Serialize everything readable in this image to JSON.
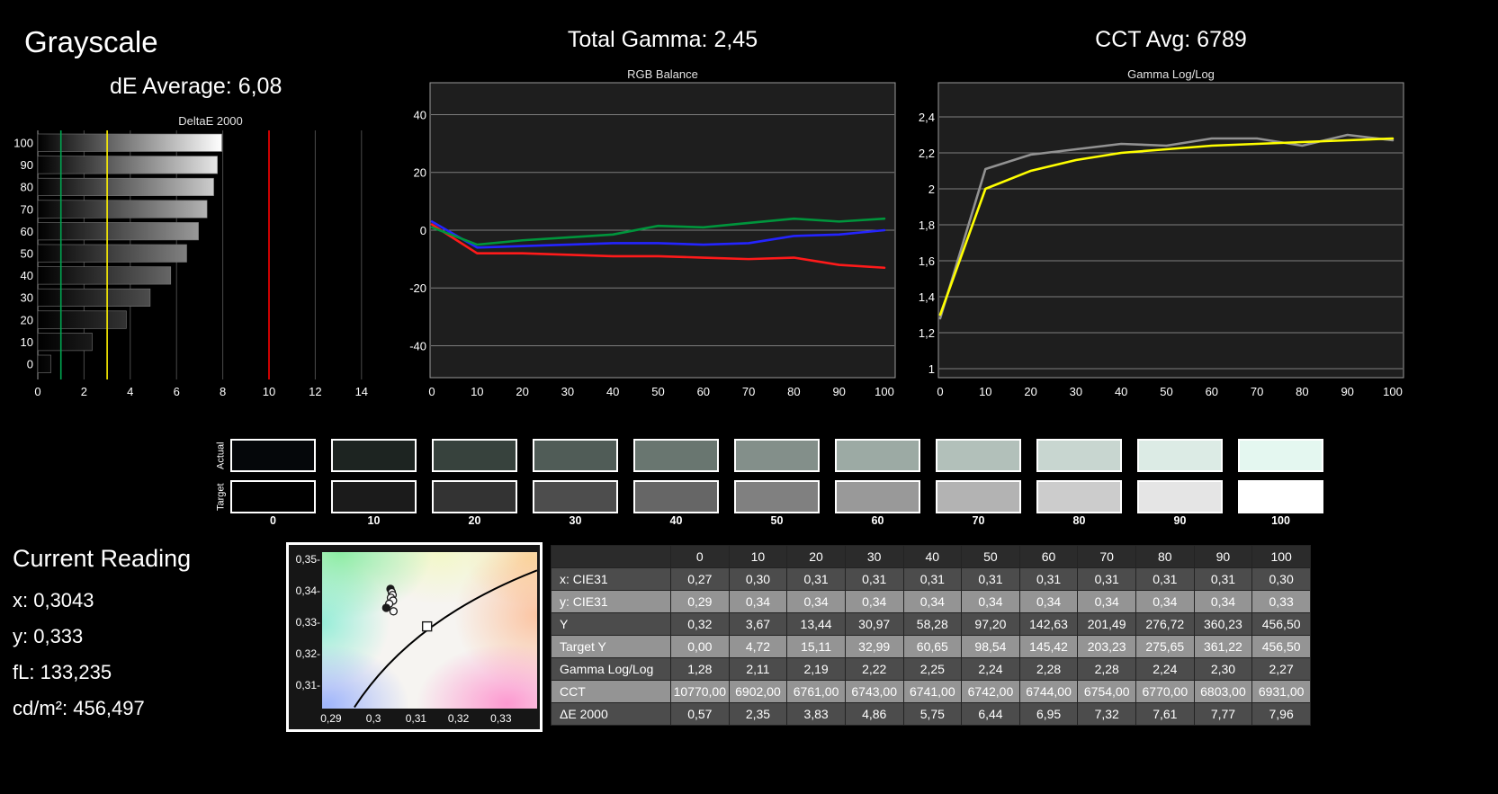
{
  "titles": {
    "grayscale": "Grayscale",
    "de_average": "dE Average: 6,08",
    "total_gamma": "Total Gamma: 2,45",
    "cct_avg": "CCT Avg: 6789"
  },
  "current_reading": {
    "title": "Current Reading",
    "lines": [
      "x: 0,3043",
      "y: 0,333",
      "fL: 133,235",
      "cd/m²: 456,497"
    ]
  },
  "swatches": {
    "row_labels": [
      "Actual",
      "Target"
    ],
    "column_labels": [
      "0",
      "10",
      "20",
      "30",
      "40",
      "50",
      "60",
      "70",
      "80",
      "90",
      "100"
    ],
    "actual_colors": [
      "#05070a",
      "#1d2421",
      "#37423d",
      "#505c57",
      "#697670",
      "#838f8a",
      "#9caaa4",
      "#b2c0ba",
      "#c8d6d0",
      "#dcebe5",
      "#e4f7f0"
    ],
    "target_colors": [
      "#000000",
      "#1b1b1b",
      "#333333",
      "#4d4d4d",
      "#666666",
      "#808080",
      "#999999",
      "#b3b3b3",
      "#cccccc",
      "#e5e5e5",
      "#ffffff"
    ]
  },
  "table": {
    "header": [
      "",
      "0",
      "10",
      "20",
      "30",
      "40",
      "50",
      "60",
      "70",
      "80",
      "90",
      "100"
    ],
    "rows": [
      {
        "label": "x: CIE31",
        "values": [
          "0,27",
          "0,30",
          "0,31",
          "0,31",
          "0,31",
          "0,31",
          "0,31",
          "0,31",
          "0,31",
          "0,31",
          "0,30"
        ]
      },
      {
        "label": "y: CIE31",
        "values": [
          "0,29",
          "0,34",
          "0,34",
          "0,34",
          "0,34",
          "0,34",
          "0,34",
          "0,34",
          "0,34",
          "0,34",
          "0,33"
        ]
      },
      {
        "label": "Y",
        "values": [
          "0,32",
          "3,67",
          "13,44",
          "30,97",
          "58,28",
          "97,20",
          "142,63",
          "201,49",
          "276,72",
          "360,23",
          "456,50"
        ]
      },
      {
        "label": "Target Y",
        "values": [
          "0,00",
          "4,72",
          "15,11",
          "32,99",
          "60,65",
          "98,54",
          "145,42",
          "203,23",
          "275,65",
          "361,22",
          "456,50"
        ]
      },
      {
        "label": "Gamma Log/Log",
        "values": [
          "1,28",
          "2,11",
          "2,19",
          "2,22",
          "2,25",
          "2,24",
          "2,28",
          "2,28",
          "2,24",
          "2,30",
          "2,27"
        ]
      },
      {
        "label": "CCT",
        "values": [
          "10770,00",
          "6902,00",
          "6761,00",
          "6743,00",
          "6741,00",
          "6742,00",
          "6744,00",
          "6754,00",
          "6770,00",
          "6803,00",
          "6931,00"
        ]
      },
      {
        "label": "ΔE 2000",
        "values": [
          "0,57",
          "2,35",
          "3,83",
          "4,86",
          "5,75",
          "6,44",
          "6,95",
          "7,32",
          "7,61",
          "7,77",
          "7,96"
        ]
      }
    ]
  },
  "chart_data": [
    {
      "id": "deltae",
      "type": "bar",
      "orientation": "horizontal",
      "title": "DeltaE 2000",
      "categories": [
        "100",
        "90",
        "80",
        "70",
        "60",
        "50",
        "40",
        "30",
        "20",
        "10",
        "0"
      ],
      "values": [
        7.96,
        7.77,
        7.61,
        7.32,
        6.95,
        6.44,
        5.75,
        4.86,
        3.83,
        2.35,
        0.57
      ],
      "bar_colors": [
        "#ffffff",
        "#e6e6e6",
        "#cccccc",
        "#b3b3b3",
        "#999999",
        "#808080",
        "#666666",
        "#4d4d4d",
        "#333333",
        "#1a1a1a",
        "#0a0a0a"
      ],
      "xlim": [
        0,
        15.5
      ],
      "xticks": [
        0,
        2,
        4,
        6,
        8,
        10,
        12,
        14
      ],
      "xlabel": "",
      "ylabel": "",
      "reference_lines": [
        {
          "x": 1,
          "color": "#00a651"
        },
        {
          "x": 3,
          "color": "#fff200"
        },
        {
          "x": 10,
          "color": "#ff0000"
        }
      ]
    },
    {
      "id": "rgb_balance",
      "type": "line",
      "title": "RGB Balance",
      "x": [
        0,
        10,
        20,
        30,
        40,
        50,
        60,
        70,
        80,
        90,
        100
      ],
      "xticks": [
        0,
        10,
        20,
        30,
        40,
        50,
        60,
        70,
        80,
        90,
        100
      ],
      "ylim": [
        -50,
        50
      ],
      "yticks": [
        40,
        20,
        0,
        -20,
        -40
      ],
      "xlabel": "",
      "ylabel": "",
      "series": [
        {
          "name": "red",
          "color": "#ff1a1a",
          "values": [
            2,
            -8,
            -8,
            -8.5,
            -9,
            -9,
            -9.5,
            -10,
            -9.5,
            -12,
            -13
          ]
        },
        {
          "name": "blue",
          "color": "#2424ff",
          "values": [
            3,
            -6,
            -5.5,
            -5,
            -4.5,
            -4.5,
            -5,
            -4.5,
            -2,
            -1.5,
            0
          ]
        },
        {
          "name": "green",
          "color": "#00953c",
          "values": [
            1,
            -5,
            -3.5,
            -2.5,
            -1.5,
            1.5,
            1,
            2.5,
            4,
            3,
            4
          ]
        }
      ]
    },
    {
      "id": "gamma",
      "type": "line",
      "title": "Gamma Log/Log",
      "x": [
        0,
        10,
        20,
        30,
        40,
        50,
        60,
        70,
        80,
        90,
        100
      ],
      "xticks": [
        0,
        10,
        20,
        30,
        40,
        50,
        60,
        70,
        80,
        90,
        100
      ],
      "ylim": [
        0.95,
        2.59
      ],
      "yticks": [
        2.4,
        2.2,
        2,
        1.8,
        1.6,
        1.4,
        1.2,
        1
      ],
      "xlabel": "",
      "ylabel": "",
      "series": [
        {
          "name": "measured",
          "color": "#929292",
          "values": [
            1.28,
            2.11,
            2.19,
            2.22,
            2.25,
            2.24,
            2.28,
            2.28,
            2.24,
            2.3,
            2.27
          ]
        },
        {
          "name": "target",
          "color": "#ffff00",
          "values": [
            1.3,
            2.0,
            2.1,
            2.16,
            2.2,
            2.22,
            2.24,
            2.25,
            2.26,
            2.27,
            2.28
          ]
        }
      ]
    },
    {
      "id": "cie",
      "type": "scatter",
      "title": "CIE xy chromaticity",
      "xlim": [
        0.2879,
        0.3385
      ],
      "ylim": [
        0.3026,
        0.3523
      ],
      "xticks": [
        0.29,
        0.3,
        0.31,
        0.32,
        0.33
      ],
      "yticks": [
        0.35,
        0.34,
        0.33,
        0.32,
        0.31
      ],
      "measured_points": [
        {
          "x": 0.304,
          "y": 0.3406,
          "filled": true
        },
        {
          "x": 0.3043,
          "y": 0.3396,
          "filled": false
        },
        {
          "x": 0.3045,
          "y": 0.3387,
          "filled": false
        },
        {
          "x": 0.3041,
          "y": 0.3378,
          "filled": false
        },
        {
          "x": 0.3046,
          "y": 0.3369,
          "filled": false
        },
        {
          "x": 0.3037,
          "y": 0.3359,
          "filled": false
        },
        {
          "x": 0.303,
          "y": 0.3346,
          "filled": true
        },
        {
          "x": 0.3047,
          "y": 0.3335,
          "filled": false
        }
      ],
      "target_point": {
        "x": 0.3126,
        "y": 0.3287
      },
      "locus_curve": {
        "start": {
          "x": 0.2955,
          "y": 0.303
        },
        "control": {
          "x": 0.309,
          "y": 0.331
        },
        "end": {
          "x": 0.3385,
          "y": 0.3465
        }
      }
    }
  ]
}
